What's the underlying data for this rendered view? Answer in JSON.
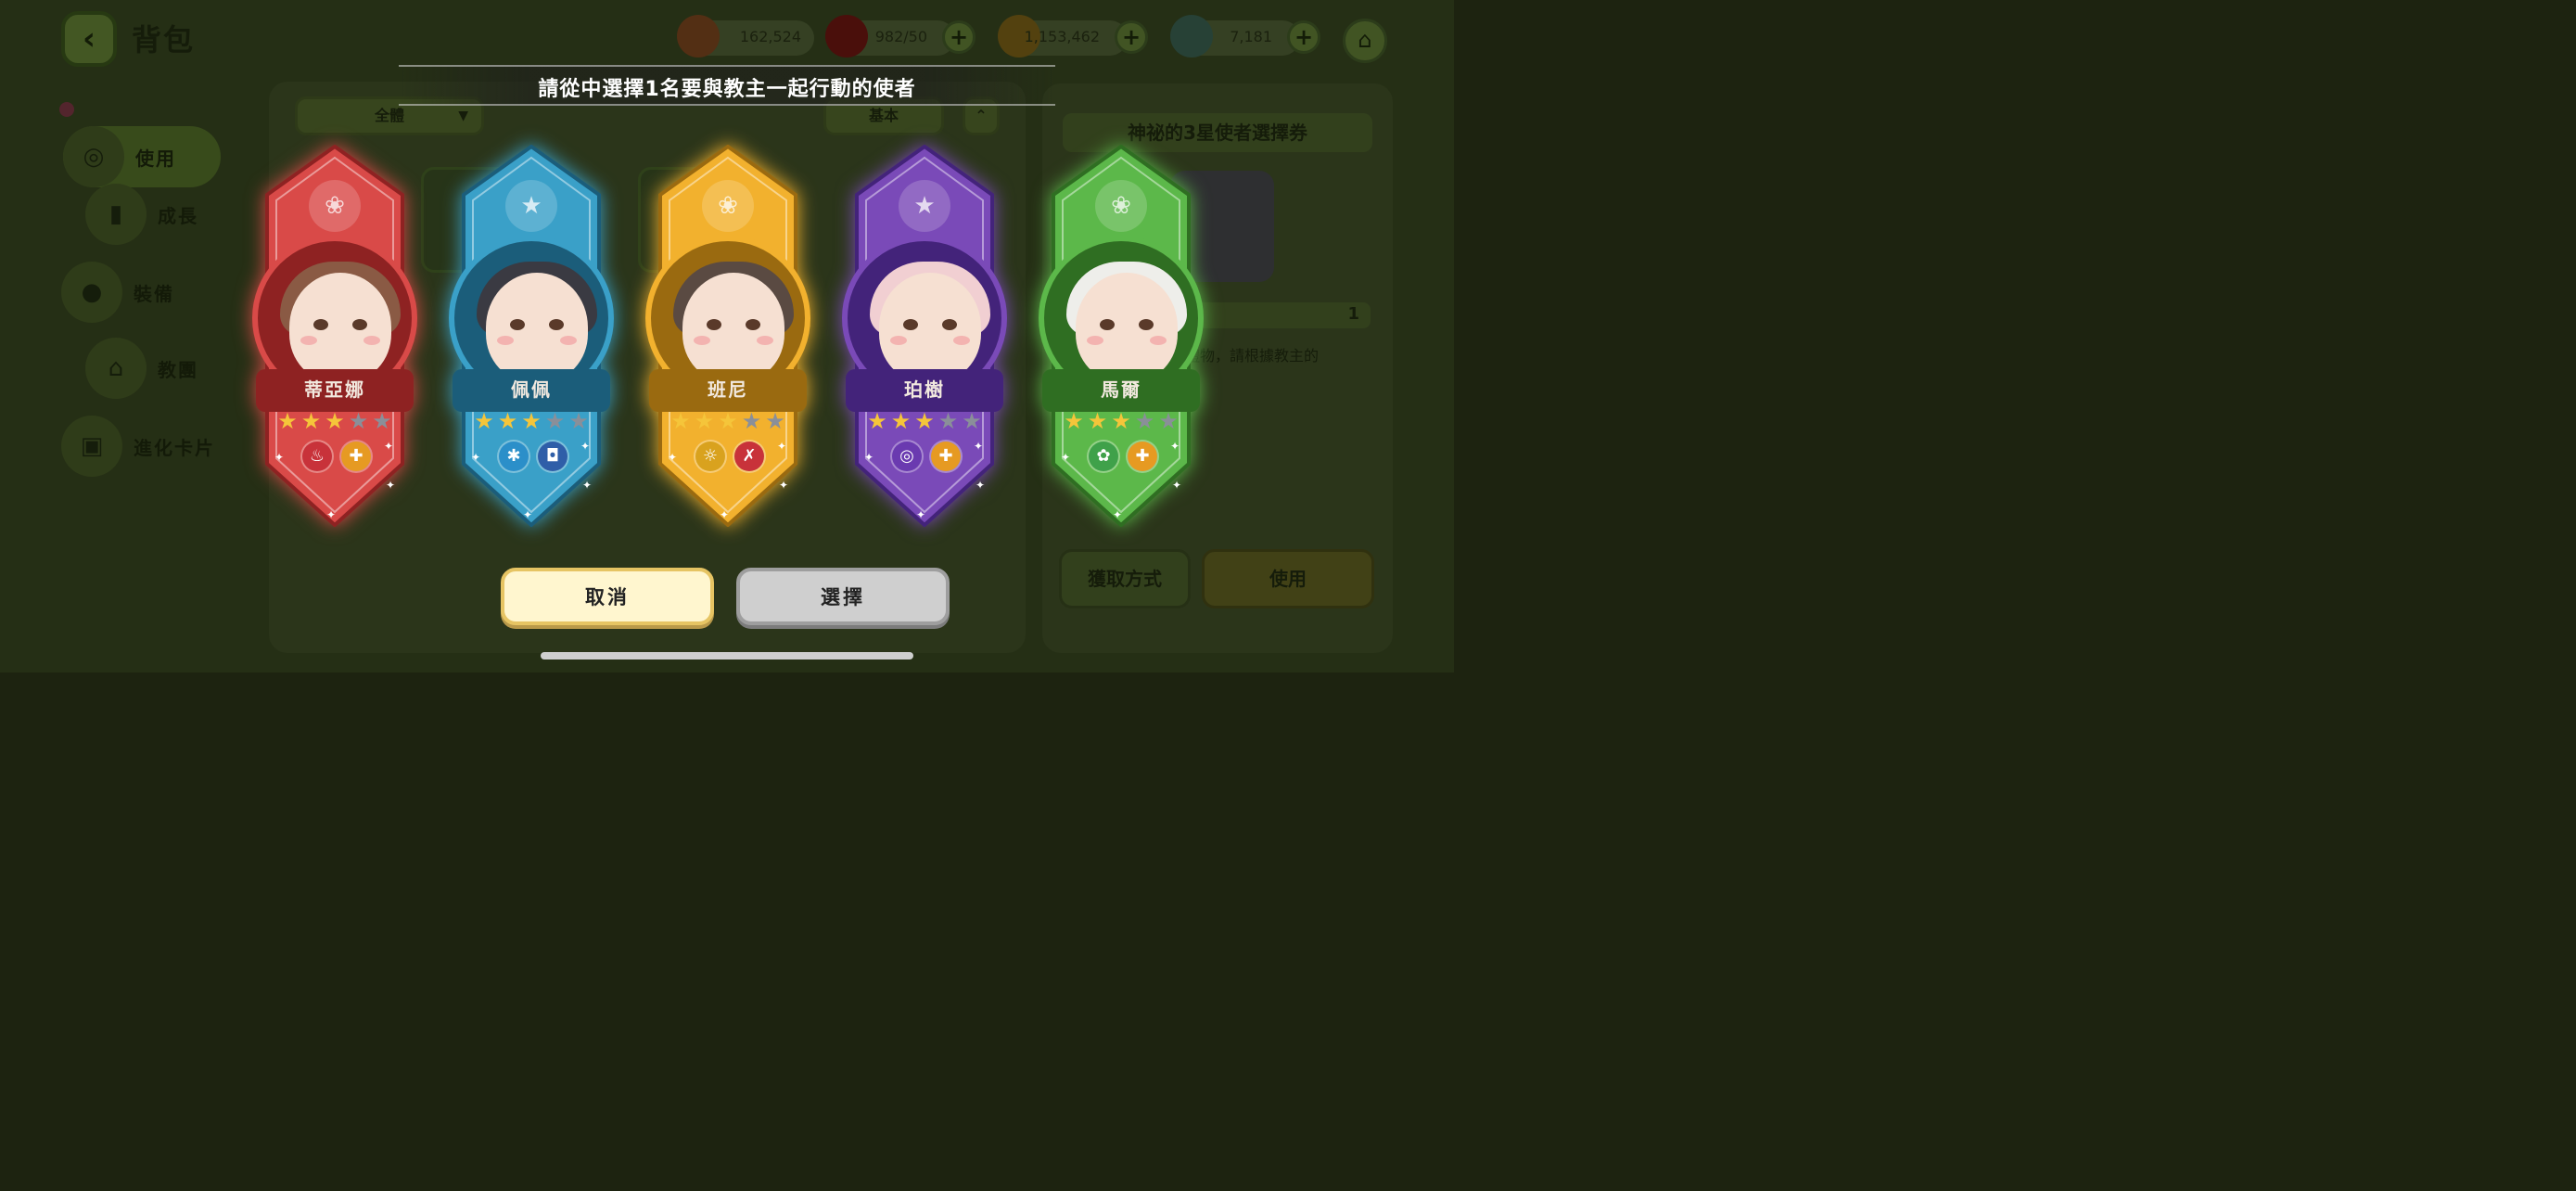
{
  "background": {
    "page_title": "背包",
    "currencies": [
      {
        "icon": "macaron-icon",
        "value": "162,524",
        "has_plus": false
      },
      {
        "icon": "red-gem-icon",
        "value": "982/50",
        "has_plus": true
      },
      {
        "icon": "gold-coin-icon",
        "value": "1,153,462",
        "has_plus": true
      },
      {
        "icon": "butterfly-icon",
        "value": "7,181",
        "has_plus": true
      }
    ],
    "sidebar": [
      {
        "label": "使用",
        "icon": "use-icon",
        "active": true
      },
      {
        "label": "成長",
        "icon": "growth-icon",
        "active": false
      },
      {
        "label": "裝備",
        "icon": "equipment-icon",
        "active": false
      },
      {
        "label": "教團",
        "icon": "cult-icon",
        "active": false
      },
      {
        "label": "進化卡片",
        "icon": "evolution-card-icon",
        "active": false
      }
    ],
    "filter_label": "全體",
    "sort_label": "基本",
    "detail": {
      "title": "神祕的3星使者選擇券",
      "count": "1",
      "description": "禮物，請根據教主的"
    },
    "acquire_label": "獲取方式",
    "use_label": "使用"
  },
  "modal": {
    "title": "請從中選擇1名要與教主一起行動的使者",
    "cancel_label": "取消",
    "select_label": "選擇",
    "cards": [
      {
        "name": "蒂亞娜",
        "stars_filled": 3,
        "stars_total": 5,
        "theme": "#d94a48",
        "dark": "#8e2222",
        "class_icon": "paw-icon",
        "attrs": [
          {
            "icon": "fire-icon",
            "color": "#c8323a"
          },
          {
            "icon": "cross-icon",
            "color": "#e69a22"
          }
        ],
        "hair": "#8a5a44"
      },
      {
        "name": "佩佩",
        "stars_filled": 3,
        "stars_total": 5,
        "theme": "#3aa0c8",
        "dark": "#1b5d7a",
        "class_icon": "star-icon",
        "attrs": [
          {
            "icon": "snowflake-icon",
            "color": "#2b8fc9"
          },
          {
            "icon": "shield-icon",
            "color": "#2f5ea8"
          }
        ],
        "hair": "#3a3a42"
      },
      {
        "name": "班尼",
        "stars_filled": 3,
        "stars_total": 5,
        "theme": "#f2b12e",
        "dark": "#9a6a10",
        "class_icon": "paw-icon",
        "attrs": [
          {
            "icon": "sun-icon",
            "color": "#d9a21e"
          },
          {
            "icon": "tools-icon",
            "color": "#c8323a"
          }
        ],
        "hair": "#5a4a42"
      },
      {
        "name": "珀樹",
        "stars_filled": 3,
        "stars_total": 5,
        "theme": "#7a4ab8",
        "dark": "#43237a",
        "class_icon": "star-icon",
        "attrs": [
          {
            "icon": "swirl-icon",
            "color": "#6a3ab0"
          },
          {
            "icon": "cross-icon",
            "color": "#e69a22"
          }
        ],
        "hair": "#f1cfd2"
      },
      {
        "name": "馬爾",
        "stars_filled": 3,
        "stars_total": 5,
        "theme": "#5cb84a",
        "dark": "#2f6e22",
        "class_icon": "paw-icon",
        "attrs": [
          {
            "icon": "clover-icon",
            "color": "#3fa14a"
          },
          {
            "icon": "cross-icon",
            "color": "#e69a22"
          }
        ],
        "hair": "#eeeeea"
      }
    ]
  }
}
